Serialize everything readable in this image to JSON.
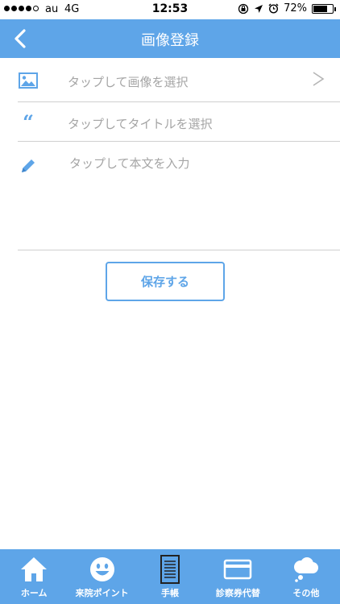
{
  "status_bar": {
    "carrier": "au",
    "network": "4G",
    "time": "12:53",
    "battery": "72%",
    "battery_level": 0.72,
    "signal_bars_filled": 4,
    "signal_bars_total": 5
  },
  "nav": {
    "title": "画像登録",
    "back_icon": "chevron-left-icon"
  },
  "form": {
    "image_row": {
      "label": "タップして画像を選択",
      "icon": "image-icon",
      "chevron": ">"
    },
    "title_row": {
      "label": "タップしてタイトルを選択",
      "icon": "quote-icon",
      "glyph": "“"
    },
    "body_row": {
      "label": "タップして本文を入力",
      "icon": "pencil-icon"
    }
  },
  "save_button": {
    "label": "保存する"
  },
  "tabs": [
    {
      "label": "ホーム",
      "icon": "home-icon"
    },
    {
      "label": "来院ポイント",
      "icon": "smiley-icon"
    },
    {
      "label": "手帳",
      "icon": "notebook-icon"
    },
    {
      "label": "診察券代替",
      "icon": "card-icon"
    },
    {
      "label": "その他",
      "icon": "cloud-icon"
    }
  ],
  "colors": {
    "accent": "#5ea5e8",
    "placeholder_text": "#a5a5a5",
    "divider": "#cfcfcf"
  }
}
